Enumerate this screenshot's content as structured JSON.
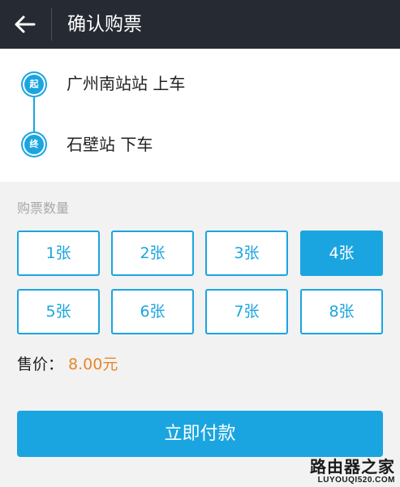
{
  "header": {
    "back_icon": "arrow-left-icon",
    "title": "确认购票"
  },
  "route": {
    "start": {
      "marker": "起",
      "label": "广州南站站 上车"
    },
    "end": {
      "marker": "终",
      "label": "石壁站 下车"
    }
  },
  "quantity": {
    "title": "购票数量",
    "options": [
      "1张",
      "2张",
      "3张",
      "4张",
      "5张",
      "6张",
      "7张",
      "8张"
    ],
    "selected": "4张"
  },
  "price": {
    "label": "售价：",
    "value": "8.00元"
  },
  "pay_button": {
    "label": "立即付款"
  },
  "watermark": {
    "text": "路由器之家",
    "domain": "LUYOUQI520.COM"
  },
  "colors": {
    "header_bg": "#262a33",
    "accent": "#1ba5e0",
    "price": "#e8872a",
    "page_bg": "#f2f2f2"
  }
}
